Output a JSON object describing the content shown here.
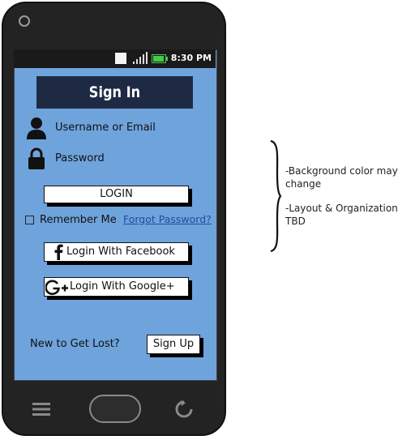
{
  "status_bar": {
    "time": "8:30 PM"
  },
  "header": {
    "title": "Sign In"
  },
  "form": {
    "username_label": "Username or Email",
    "password_label": "Password",
    "login_button": "LOGIN",
    "remember_me_label": "Remember Me",
    "forgot_password_link": "Forgot Password?",
    "facebook_button": "Login With Facebook",
    "google_button": "Login With Google+"
  },
  "footer": {
    "prompt": "New to Get Lost?",
    "signup_button": "Sign Up"
  },
  "annotations": {
    "note1": "-Background color may change",
    "note2": "-Layout & Organization TBD"
  },
  "icons": {
    "user": "user-icon",
    "lock": "lock-icon",
    "facebook": "facebook-icon",
    "google": "google-plus-icon",
    "menu": "menu-icon",
    "refresh": "refresh-icon",
    "wifi": "wifi-icon",
    "signal": "signal-icon",
    "battery": "battery-icon"
  },
  "colors": {
    "screen_bg": "#6fa3dc",
    "header_bg": "#1e2a44",
    "phone_body": "#232323",
    "link": "#1f4c9e"
  }
}
